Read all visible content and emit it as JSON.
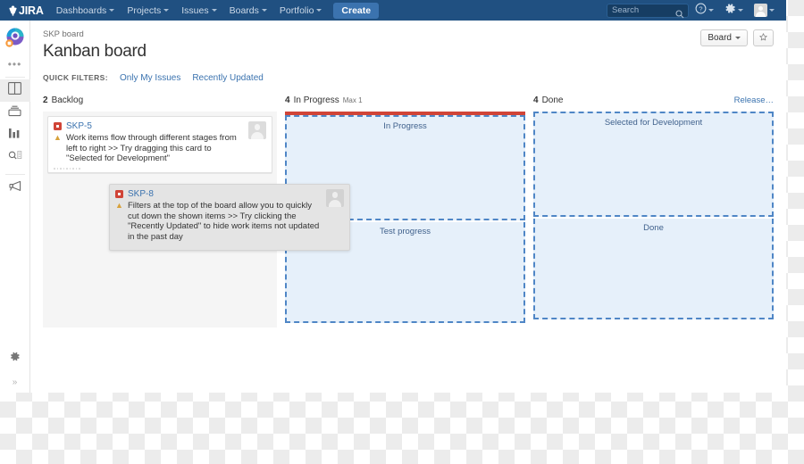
{
  "topnav": {
    "logo_text": "JIRA",
    "items": [
      {
        "label": "Dashboards",
        "has_caret": true
      },
      {
        "label": "Projects",
        "has_caret": true
      },
      {
        "label": "Issues",
        "has_caret": true
      },
      {
        "label": "Boards",
        "has_caret": true
      },
      {
        "label": "Portfolio",
        "has_caret": true
      }
    ],
    "create_label": "Create",
    "search_placeholder": "Search",
    "search_value": "",
    "help_icon": "question-circle-icon",
    "settings_icon": "gear-icon",
    "profile_icon": "user-avatar-icon"
  },
  "sidebar": {
    "project_avatar": "project-avatar-icon",
    "more_label": "•••",
    "items": [
      {
        "icon": "board-columns-icon",
        "name": "board",
        "active": true
      },
      {
        "icon": "backlog-stack-icon",
        "name": "backlog",
        "active": false
      },
      {
        "icon": "reports-bar-chart-icon",
        "name": "reports",
        "active": false
      },
      {
        "icon": "issues-search-icon",
        "name": "issues",
        "active": false
      },
      {
        "icon": "megaphone-icon",
        "name": "releases",
        "active": false
      }
    ],
    "settings_icon": "gear-icon",
    "expand_label": "»"
  },
  "header": {
    "breadcrumb": "SKP board",
    "title": "Kanban board",
    "board_button": "Board",
    "star_button_icon": "star-icon"
  },
  "quick_filters": {
    "label": "QUICK FILTERS:",
    "filters": [
      {
        "label": "Only My Issues"
      },
      {
        "label": "Recently Updated"
      }
    ]
  },
  "board": {
    "columns": [
      {
        "count": "2",
        "name": "Backlog",
        "max": "",
        "release_link": ""
      },
      {
        "count": "4",
        "name": "In Progress",
        "max": "Max 1",
        "release_link": "",
        "wip_exceeded": true,
        "wip_color": "#d04437"
      },
      {
        "count": "4",
        "name": "Done",
        "max": "",
        "release_link": "Release…"
      }
    ],
    "cards": [
      {
        "key": "SKP-5",
        "summary": "Work items flow through different stages from left to right >> Try dragging this card to \"Selected for Development\"",
        "type_icon": "story-icon",
        "priority_icon": "priority-major-up-icon",
        "avatar_icon": "user-avatar-icon"
      }
    ],
    "dragging_card": {
      "key": "SKP-8",
      "summary": "Filters at the top of the board allow you to quickly cut down the shown items >> Try clicking the \"Recently Updated\" to hide work items not updated in the past day",
      "type_icon": "story-icon",
      "priority_icon": "priority-major-up-icon",
      "avatar_icon": "user-avatar-icon"
    },
    "dropzones": [
      {
        "label": "In Progress",
        "column": "in-progress",
        "position": "top"
      },
      {
        "label": "Test progress",
        "column": "in-progress",
        "position": "bottom"
      },
      {
        "label": "Selected for Development",
        "column": "done",
        "position": "top"
      },
      {
        "label": "Done",
        "column": "done",
        "position": "bottom"
      }
    ]
  },
  "colors": {
    "nav_blue": "#205081",
    "link_blue": "#3b73af",
    "wip_red": "#d04437",
    "dropzone_border": "#4f86c6",
    "dropzone_fill": "#e6f0fa"
  }
}
